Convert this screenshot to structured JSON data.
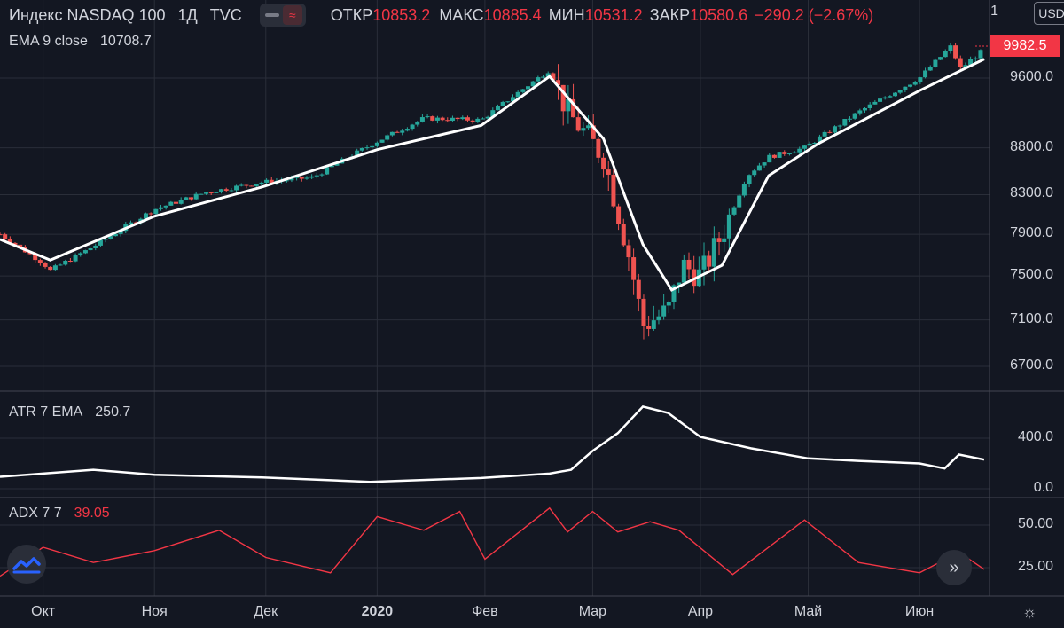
{
  "symbol": {
    "name": "Индекс NASDAQ 100",
    "interval": "1Д",
    "source": "TVC",
    "open_label": "ОТКР",
    "open": "10853.2",
    "high_label": "МАКС",
    "high": "10885.4",
    "low_label": "МИН",
    "low": "10531.2",
    "close_label": "ЗАКР",
    "close": "10580.6",
    "change": "−290.2 (−2.67%)"
  },
  "currency": "USD",
  "price_badge": "9982.5",
  "axis_top_fragment": "1",
  "indicators": {
    "ema": {
      "label": "EMA 9 close",
      "value": "10708.7"
    },
    "atr": {
      "label": "ATR 7 EMA",
      "value": "250.7"
    },
    "adx": {
      "label": "ADX 7 7",
      "value": "39.05"
    }
  },
  "colors": {
    "up": "#26a69a",
    "down": "#ef5350",
    "ema": "#ffffff",
    "atr": "#ffffff",
    "adx": "#f23645",
    "bg": "#131722",
    "grid": "#2a2e39"
  },
  "icons": {
    "toggle": "minus-icon",
    "wave": "wave-icon",
    "logo": "tradingview-logo-icon",
    "scroll": "double-chevron-right-icon",
    "settings": "gear-icon"
  },
  "chart_data": [
    {
      "type": "candlestick",
      "title": "Индекс NASDAQ 100",
      "yscale": "log",
      "price_ticks": [
        "9600.0",
        "8800.0",
        "8300.0",
        "7900.0",
        "7500.0",
        "7100.0",
        "6700.0"
      ],
      "time_ticks": [
        "Окт",
        "Ноя",
        "Дек",
        "2020",
        "Фев",
        "Мар",
        "Апр",
        "Май",
        "Июн"
      ],
      "ylim": [
        6500,
        10300
      ],
      "close_path": [
        [
          "Sep 19",
          7900
        ],
        [
          "Oct 1",
          7620
        ],
        [
          "Oct 3",
          7550
        ],
        [
          "Oct 15",
          7780
        ],
        [
          "Nov 1",
          8150
        ],
        [
          "Nov 15",
          8320
        ],
        [
          "Dec 1",
          8430
        ],
        [
          "Dec 15",
          8480
        ],
        [
          "Jan 2",
          8870
        ],
        [
          "Jan 15",
          9130
        ],
        [
          "Jan 31",
          9110
        ],
        [
          "Feb 19",
          9700
        ],
        [
          "Feb 24",
          9200
        ],
        [
          "Mar 5",
          8700
        ],
        [
          "Mar 12",
          7700
        ],
        [
          "Mar 16",
          7050
        ],
        [
          "Mar 23",
          7180
        ],
        [
          "Mar 27",
          7600
        ],
        [
          "Apr 1",
          7500
        ],
        [
          "Apr 7",
          7900
        ],
        [
          "Apr 14",
          8500
        ],
        [
          "Apr 20",
          8700
        ],
        [
          "Apr 30",
          8800
        ],
        [
          "May 15",
          9200
        ],
        [
          "Jun 1",
          9600
        ],
        [
          "Jun 10",
          10000
        ],
        [
          "Jun 12",
          9700
        ],
        [
          "Jun 19",
          9950
        ]
      ],
      "ema_9_close_path": [
        [
          "Sep 19",
          7850
        ],
        [
          "Oct 3",
          7650
        ],
        [
          "Nov 1",
          8080
        ],
        [
          "Dec 1",
          8380
        ],
        [
          "Jan 2",
          8780
        ],
        [
          "Jan 31",
          9050
        ],
        [
          "Feb 19",
          9620
        ],
        [
          "Mar 5",
          8900
        ],
        [
          "Mar 16",
          7800
        ],
        [
          "Mar 24",
          7370
        ],
        [
          "Apr 7",
          7600
        ],
        [
          "Apr 20",
          8500
        ],
        [
          "May 4",
          8850
        ],
        [
          "Jun 1",
          9450
        ],
        [
          "Jun 19",
          9830
        ]
      ]
    },
    {
      "type": "line",
      "title": "ATR 7 EMA",
      "y_ticks": [
        "400.0",
        "0.0"
      ],
      "ylim": [
        0,
        700
      ],
      "series": [
        {
          "name": "ATR 7 EMA",
          "values": [
            [
              "Sep 19",
              95
            ],
            [
              "Oct 15",
              150
            ],
            [
              "Nov 1",
              110
            ],
            [
              "Dec 1",
              90
            ],
            [
              "Dec 31",
              55
            ],
            [
              "Jan 31",
              85
            ],
            [
              "Feb 19",
              120
            ],
            [
              "Feb 25",
              150
            ],
            [
              "Mar 2",
              300
            ],
            [
              "Mar 9",
              440
            ],
            [
              "Mar 16",
              650
            ],
            [
              "Mar 23",
              600
            ],
            [
              "Apr 1",
              410
            ],
            [
              "Apr 15",
              320
            ],
            [
              "May 1",
              240
            ],
            [
              "May 15",
              220
            ],
            [
              "Jun 1",
              200
            ],
            [
              "Jun 8",
              160
            ],
            [
              "Jun 12",
              270
            ],
            [
              "Jun 19",
              230
            ]
          ]
        }
      ]
    },
    {
      "type": "line",
      "title": "ADX 7 7",
      "y_ticks": [
        "50.00",
        "25.00"
      ],
      "ylim": [
        10,
        63
      ],
      "series": [
        {
          "name": "ADX 7 7",
          "values": [
            [
              "Sep 19",
              20
            ],
            [
              "Oct 1",
              37
            ],
            [
              "Oct 15",
              28
            ],
            [
              "Nov 1",
              35
            ],
            [
              "Nov 19",
              47
            ],
            [
              "Dec 2",
              31
            ],
            [
              "Dec 20",
              22
            ],
            [
              "Jan 2",
              55
            ],
            [
              "Jan 15",
              47
            ],
            [
              "Jan 25",
              58
            ],
            [
              "Feb 1",
              30
            ],
            [
              "Feb 19",
              60
            ],
            [
              "Feb 24",
              46
            ],
            [
              "Mar 2",
              58
            ],
            [
              "Mar 9",
              46
            ],
            [
              "Mar 18",
              52
            ],
            [
              "Mar 26",
              47
            ],
            [
              "Apr 10",
              21
            ],
            [
              "Apr 30",
              53
            ],
            [
              "May 15",
              28
            ],
            [
              "Jun 1",
              22
            ],
            [
              "Jun 12",
              34
            ],
            [
              "Jun 19",
              24
            ]
          ]
        }
      ]
    }
  ]
}
